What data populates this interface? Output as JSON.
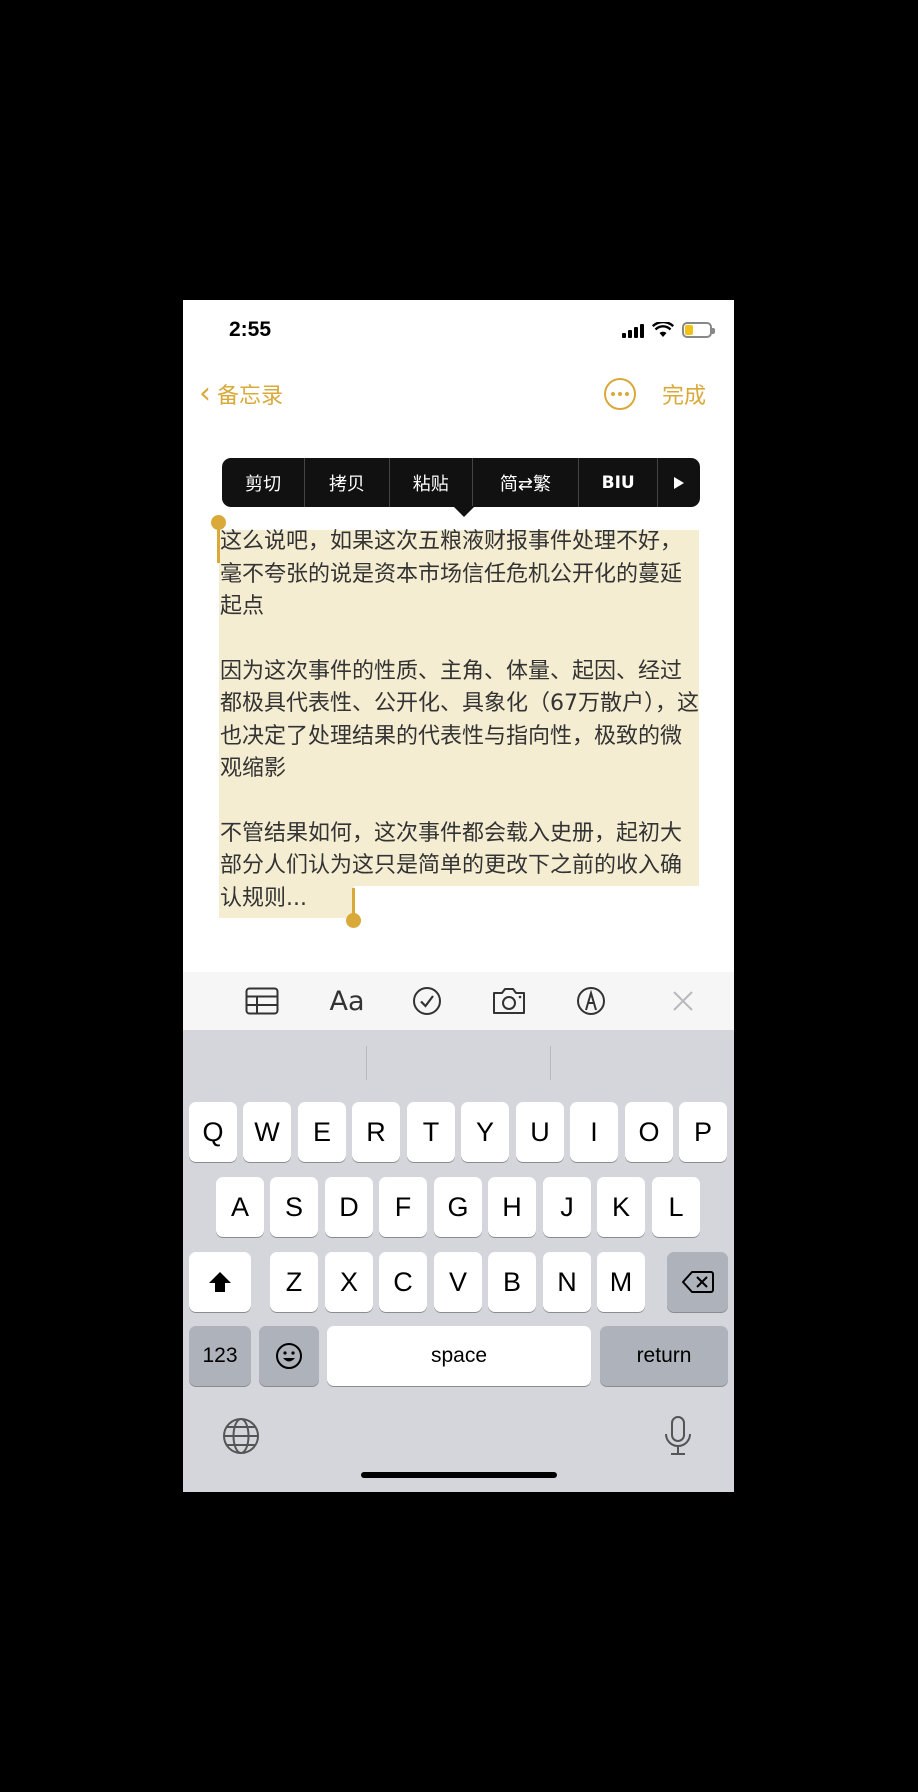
{
  "status": {
    "time": "2:55"
  },
  "nav": {
    "back_label": "备忘录",
    "done_label": "完成"
  },
  "context_menu": {
    "items": [
      {
        "label": "剪切"
      },
      {
        "label": "拷贝"
      },
      {
        "label": "粘贴"
      },
      {
        "label": "简⇄繁"
      },
      {
        "label": "BIU"
      }
    ]
  },
  "note": {
    "paragraphs": [
      "这么说吧，如果这次五粮液财报事件处理不好，毫不夸张的说是资本市场信任危机公开化的蔓延起点",
      "因为这次事件的性质、主角、体量、起因、经过都极具代表性、公开化、具象化（67万散户），这也决定了处理结果的代表性与指向性，极致的微观缩影",
      "不管结果如何，这次事件都会载入史册，起初大部分人们认为这只是简单的更改下之前的收入确认规则..."
    ]
  },
  "toolbar": {
    "format_label": "Aa"
  },
  "keyboard": {
    "row1": [
      "Q",
      "W",
      "E",
      "R",
      "T",
      "Y",
      "U",
      "I",
      "O",
      "P"
    ],
    "row2": [
      "A",
      "S",
      "D",
      "F",
      "G",
      "H",
      "J",
      "K",
      "L"
    ],
    "row3": [
      "Z",
      "X",
      "C",
      "V",
      "B",
      "N",
      "M"
    ],
    "numbers_label": "123",
    "space_label": "space",
    "return_label": "return"
  },
  "colors": {
    "accent": "#d9a93a",
    "selection": "#f5edd2",
    "keyboard_bg": "#d4d6db"
  }
}
